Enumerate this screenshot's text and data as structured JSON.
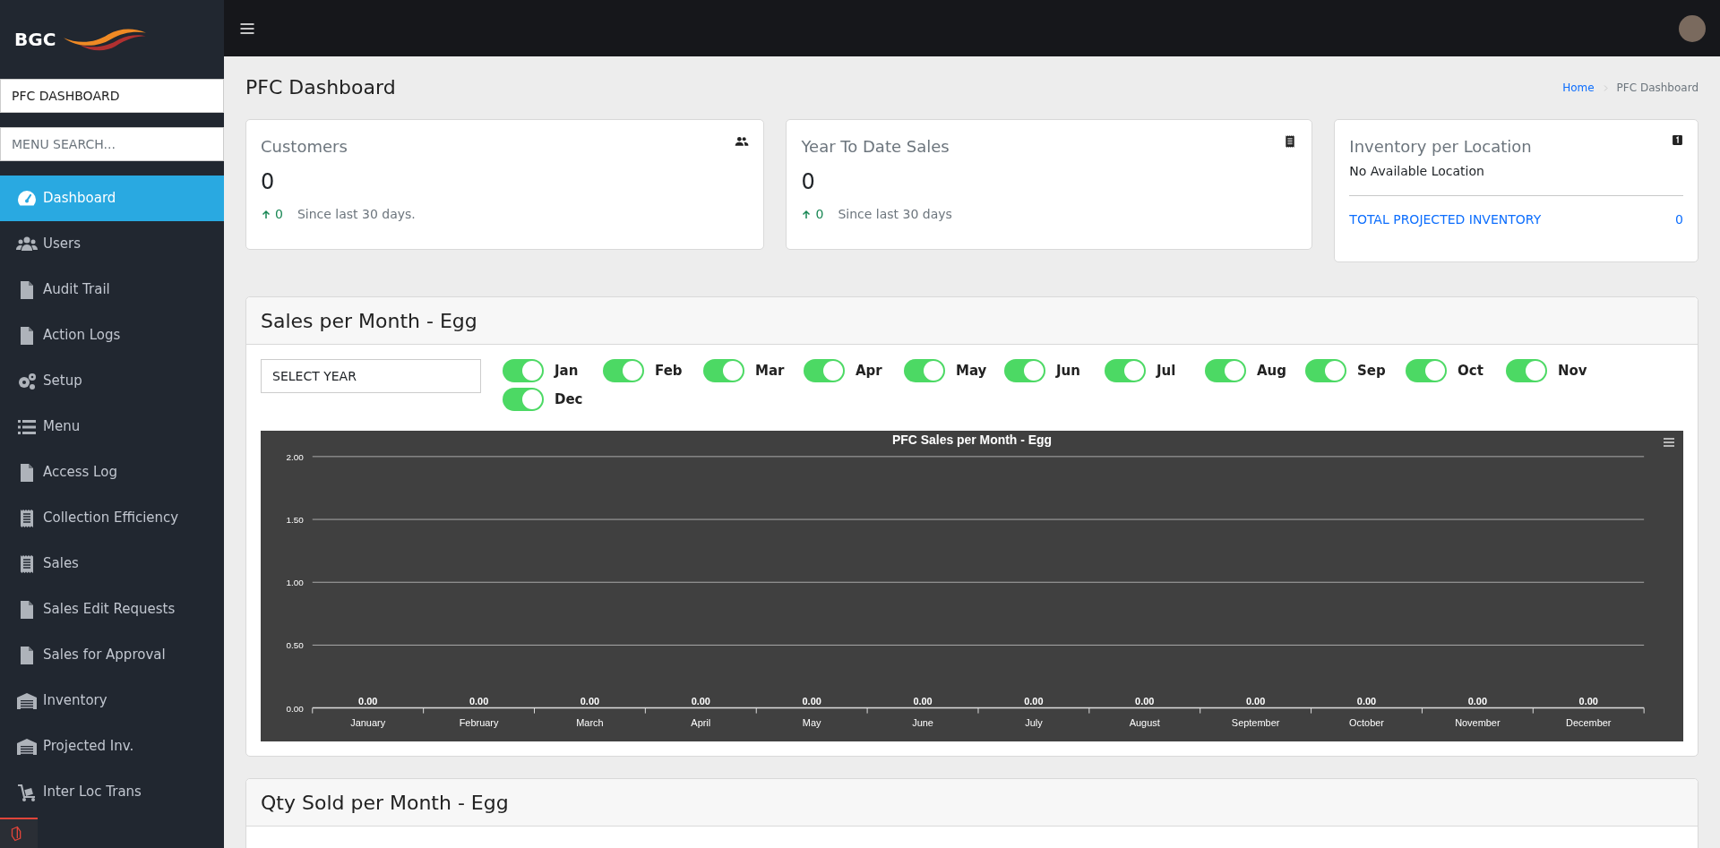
{
  "brand": {
    "text": "BGC"
  },
  "sidebar": {
    "dashboard_field": {
      "value": "PFC DASHBOARD"
    },
    "search": {
      "placeholder": "MENU SEARCH..."
    },
    "items": [
      {
        "label": "Dashboard",
        "selected": true
      },
      {
        "label": "Users",
        "selected": false
      },
      {
        "label": "Audit Trail",
        "selected": false
      },
      {
        "label": "Action Logs",
        "selected": false
      },
      {
        "label": "Setup",
        "selected": false
      },
      {
        "label": "Menu",
        "selected": false
      },
      {
        "label": "Access Log",
        "selected": false
      },
      {
        "label": "Collection Efficiency",
        "selected": false
      },
      {
        "label": "Sales",
        "selected": false
      },
      {
        "label": "Sales Edit Requests",
        "selected": false
      },
      {
        "label": "Sales for Approval",
        "selected": false
      },
      {
        "label": "Inventory",
        "selected": false
      },
      {
        "label": "Projected Inv.",
        "selected": false
      },
      {
        "label": "Inter Loc Trans",
        "selected": false
      }
    ]
  },
  "page": {
    "title": "PFC Dashboard",
    "breadcrumb": [
      {
        "label": "Home",
        "kind": "link"
      },
      {
        "label": "PFC Dashboard",
        "kind": "current"
      }
    ]
  },
  "stat_cards": [
    {
      "title": "Customers",
      "value": "0",
      "change": "0",
      "note": "Since last 30 days."
    },
    {
      "title": "Year To Date Sales",
      "value": "0",
      "change": "0",
      "note": "Since last 30 days"
    }
  ],
  "inventory_card": {
    "title": "Inventory per Location",
    "message": "No Available Location",
    "total_label": "TOTAL PROJECTED INVENTORY",
    "total_value": "0"
  },
  "sales_panel": {
    "title": "Sales per Month - Egg",
    "year_select": {
      "value": "SELECT YEAR"
    },
    "month_filters": [
      {
        "label": "Jan",
        "on": true
      },
      {
        "label": "Feb",
        "on": true
      },
      {
        "label": "Mar",
        "on": true
      },
      {
        "label": "Apr",
        "on": true
      },
      {
        "label": "May",
        "on": true
      },
      {
        "label": "Jun",
        "on": true
      },
      {
        "label": "Jul",
        "on": true
      },
      {
        "label": "Aug",
        "on": true
      },
      {
        "label": "Sep",
        "on": true
      },
      {
        "label": "Oct",
        "on": true
      },
      {
        "label": "Nov",
        "on": true
      },
      {
        "label": "Dec",
        "on": true
      }
    ],
    "chart_data": {
      "type": "bar",
      "title": "PFC Sales per Month - Egg",
      "categories": [
        "January",
        "February",
        "March",
        "April",
        "May",
        "June",
        "July",
        "August",
        "September",
        "October",
        "November",
        "December"
      ],
      "values": [
        0,
        0,
        0,
        0,
        0,
        0,
        0,
        0,
        0,
        0,
        0,
        0
      ],
      "ylim": [
        0,
        2
      ],
      "grid": true,
      "yticks": [
        {
          "value": 0,
          "label": "0.00"
        },
        {
          "value": 0.5,
          "label": "0.50"
        },
        {
          "value": 1,
          "label": "1.00"
        },
        {
          "value": 1.5,
          "label": "1.50"
        },
        {
          "value": 2,
          "label": "2.00"
        }
      ],
      "value_labels": [
        "0.00",
        "0.00",
        "0.00",
        "0.00",
        "0.00",
        "0.00",
        "0.00",
        "0.00",
        "0.00",
        "0.00",
        "0.00",
        "0.00"
      ]
    }
  },
  "qty_panel": {
    "title": "Qty Sold per Month - Egg"
  }
}
